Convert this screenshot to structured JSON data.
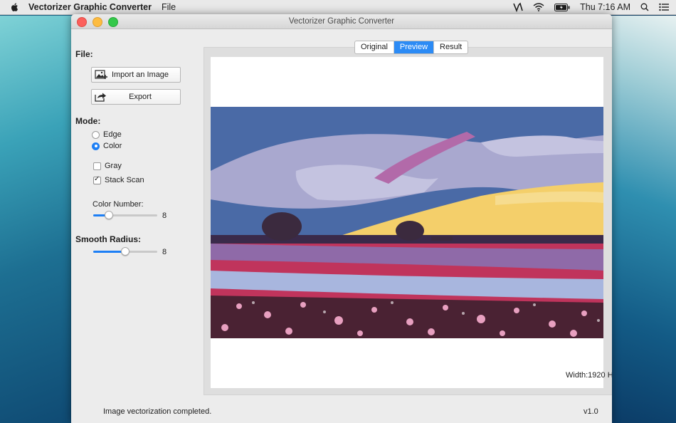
{
  "menubar": {
    "app_name": "Vectorizer Graphic Converter",
    "file_menu": "File",
    "clock": "Thu 7:16 AM"
  },
  "window": {
    "title": "Vectorizer Graphic Converter"
  },
  "left_panel": {
    "file_label": "File:",
    "import_label": "Import an Image",
    "export_label": "Export",
    "mode_label": "Mode:",
    "mode_options": [
      "Edge",
      "Color"
    ],
    "mode_selected": "Color",
    "gray_label": "Gray",
    "gray_checked": false,
    "stack_scan_label": "Stack Scan",
    "stack_scan_checked": true,
    "color_number_label": "Color Number:",
    "color_number_value": "8",
    "color_number_fraction": 0.24,
    "smooth_radius_label": "Smooth Radius:",
    "smooth_radius_value": "8",
    "smooth_radius_fraction": 0.5
  },
  "tabs": [
    {
      "label": "Original",
      "active": false
    },
    {
      "label": "Preview",
      "active": true
    },
    {
      "label": "Result",
      "active": false
    }
  ],
  "preview": {
    "dimensions_text": "Width:1920 H"
  },
  "status_bar": {
    "message": "Image vectorization completed.",
    "version": "v1.0"
  },
  "colors": {
    "accent": "#1d7ff5",
    "sky_blue": "#4a6aa6",
    "lavender": "#a9a8cf",
    "yellow": "#f4cf6a",
    "magenta": "#b26aa9",
    "tulip_red": "#c0345c",
    "dark_maroon": "#4a2233"
  }
}
